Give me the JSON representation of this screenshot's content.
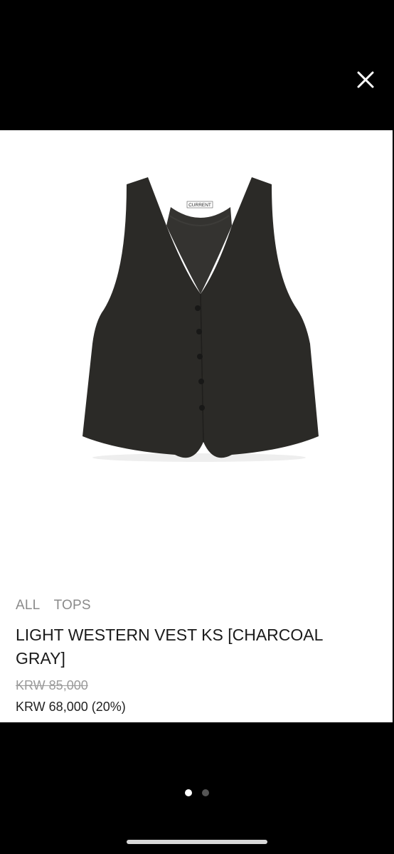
{
  "product": {
    "label_text": "CURRENT",
    "breadcrumb": [
      "ALL",
      "TOPS"
    ],
    "title": "LIGHT WESTERN VEST KS [CHARCOAL GRAY]",
    "original_price": "KRW 85,000",
    "sale_price": "KRW 68,000 (20%)"
  },
  "gallery": {
    "total_images": 2,
    "active_index": 0
  },
  "icons": {
    "close": "close-icon"
  },
  "colors": {
    "background": "#000000",
    "card": "#ffffff",
    "vest": "#2a2926"
  }
}
